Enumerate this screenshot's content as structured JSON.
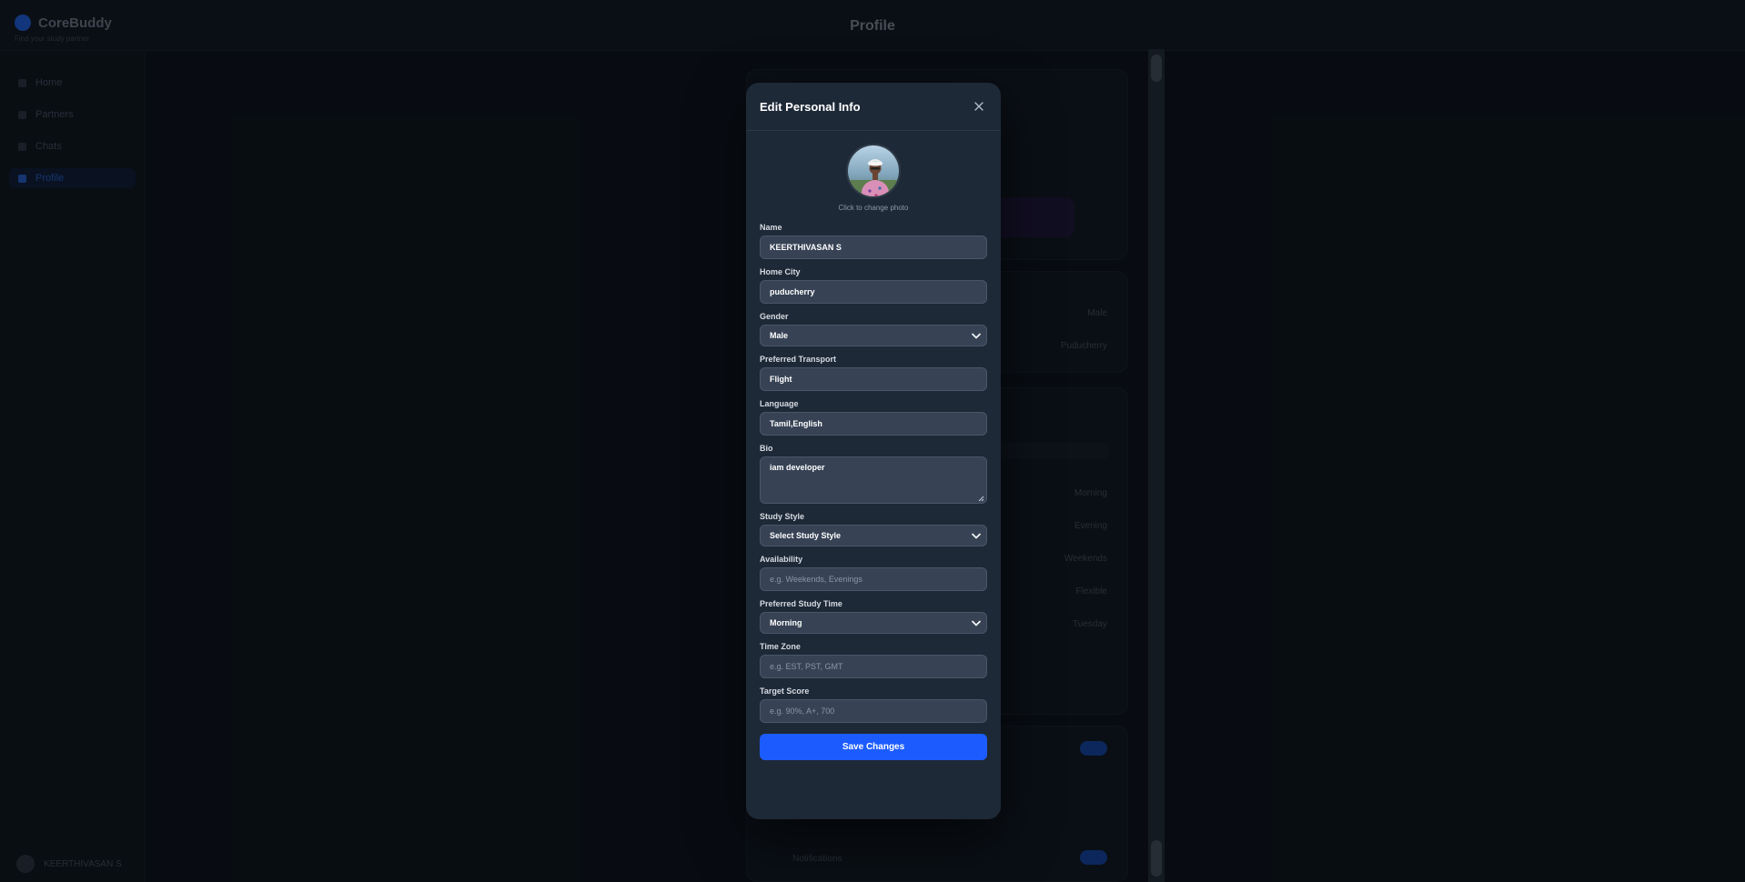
{
  "background": {
    "page_title": "Profile",
    "brand": {
      "name": "CoreBuddy",
      "tagline": "Find your study partner"
    },
    "sidebar": {
      "items": [
        {
          "label": "Home"
        },
        {
          "label": "Partners"
        },
        {
          "label": "Chats"
        },
        {
          "label": "Profile"
        }
      ],
      "user": "KEERTHIVASAN S"
    },
    "rows": [
      "Male",
      "Puducherry",
      "Morning",
      "Evening",
      "Weekends",
      "Flexible",
      "Tuesday"
    ],
    "notifications_label": "Notifications"
  },
  "modal": {
    "title": "Edit Personal Info",
    "close_icon": "close-icon",
    "photo_hint": "Click to change photo",
    "fields": {
      "name": {
        "label": "Name",
        "value": "KEERTHIVASAN S"
      },
      "home_city": {
        "label": "Home City",
        "value": "puducherry"
      },
      "gender": {
        "label": "Gender",
        "value": "Male"
      },
      "preferred_transport": {
        "label": "Preferred Transport",
        "value": "Flight"
      },
      "language": {
        "label": "Language",
        "value": "Tamil,English"
      },
      "bio": {
        "label": "Bio",
        "value": "iam developer"
      },
      "study_style": {
        "label": "Study Style",
        "value": "Select Study Style"
      },
      "availability": {
        "label": "Availability",
        "placeholder": "e.g. Weekends, Evenings"
      },
      "preferred_study_time": {
        "label": "Preferred Study Time",
        "value": "Morning"
      },
      "time_zone": {
        "label": "Time Zone",
        "placeholder": "e.g. EST, PST, GMT"
      },
      "target_score": {
        "label": "Target Score",
        "placeholder": "e.g. 90%, A+, 700"
      }
    },
    "save_label": "Save Changes"
  },
  "colors": {
    "accent": "#1c5cff",
    "modal_bg": "#1e2937",
    "input_bg": "#374355",
    "page_bg": "#0b1017"
  }
}
